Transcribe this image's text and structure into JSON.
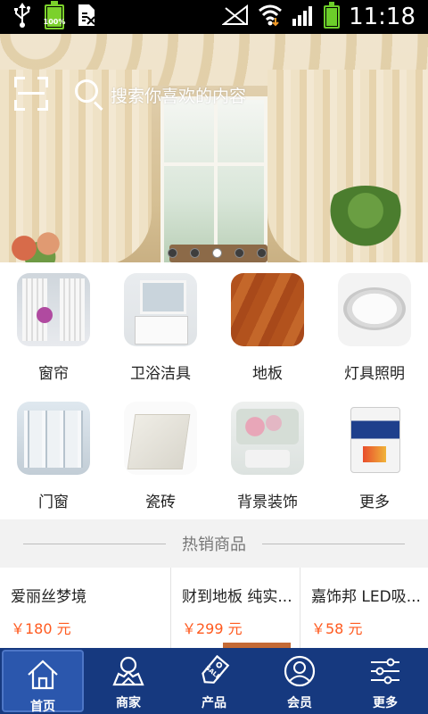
{
  "status_bar": {
    "time": "11:18",
    "battery_small_label": "100%"
  },
  "search": {
    "placeholder": "搜索你喜欢的内容"
  },
  "banner": {
    "slide_count": 5,
    "active_slide": 3
  },
  "categories": [
    {
      "label": "窗帘",
      "icon": "curtain-thumb"
    },
    {
      "label": "卫浴洁具",
      "icon": "bathroom-thumb"
    },
    {
      "label": "地板",
      "icon": "floor-thumb"
    },
    {
      "label": "灯具照明",
      "icon": "lamp-thumb"
    },
    {
      "label": "门窗",
      "icon": "door-window-thumb"
    },
    {
      "label": "瓷砖",
      "icon": "tile-thumb"
    },
    {
      "label": "背景装饰",
      "icon": "wallpaper-thumb"
    },
    {
      "label": "更多",
      "icon": "paint-bucket-thumb"
    }
  ],
  "hot_section": {
    "title": "热销商品"
  },
  "products": [
    {
      "name": "爱丽丝梦境",
      "price": "￥180 元"
    },
    {
      "name": "财到地板 纯实...",
      "price": "￥299 元"
    },
    {
      "name": "嘉饰邦 LED吸...",
      "price": "￥58 元"
    }
  ],
  "tabs": [
    {
      "label": "首页",
      "icon": "home-icon"
    },
    {
      "label": "商家",
      "icon": "merchant-icon"
    },
    {
      "label": "产品",
      "icon": "sale-tag-icon"
    },
    {
      "label": "会员",
      "icon": "member-icon"
    },
    {
      "label": "更多",
      "icon": "sliders-icon"
    }
  ],
  "colors": {
    "tabbar": "#16397f",
    "tab_active": "#2b57ad",
    "price": "#ff5a1f"
  }
}
